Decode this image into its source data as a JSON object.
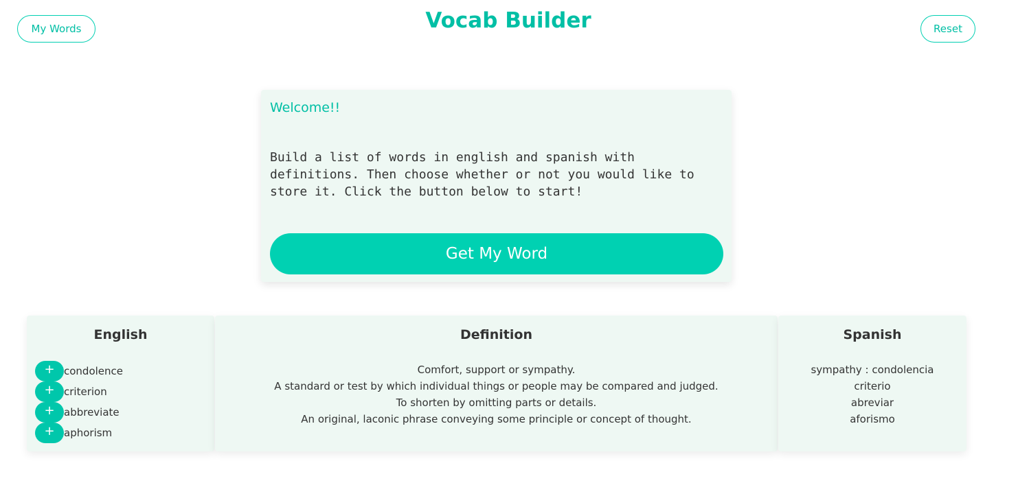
{
  "header": {
    "title": "Vocab Builder",
    "my_words_label": "My Words",
    "reset_label": "Reset"
  },
  "welcome": {
    "heading": "Welcome!!",
    "text": "Build a list of words in english and spanish with definitions. Then choose whether or not you would like to store it. Click the button below to start!",
    "button_label": "Get My Word"
  },
  "columns": {
    "english_header": "English",
    "definition_header": "Definition",
    "spanish_header": "Spanish"
  },
  "add_icon": "plus-icon",
  "words": [
    {
      "english": "condolence",
      "definition": "Comfort, support or sympathy.",
      "spanish": "sympathy : condolencia"
    },
    {
      "english": "criterion",
      "definition": "A standard or test by which individual things or people may be compared and judged.",
      "spanish": "criterio"
    },
    {
      "english": "abbreviate",
      "definition": "To shorten by omitting parts or details.",
      "spanish": "abreviar"
    },
    {
      "english": "aphorism",
      "definition": "An original, laconic phrase conveying some principle or concept of thought.",
      "spanish": "aforismo"
    }
  ],
  "colors": {
    "accent": "#00d1b2",
    "card_background": "#eef8f3",
    "text": "#333333"
  }
}
